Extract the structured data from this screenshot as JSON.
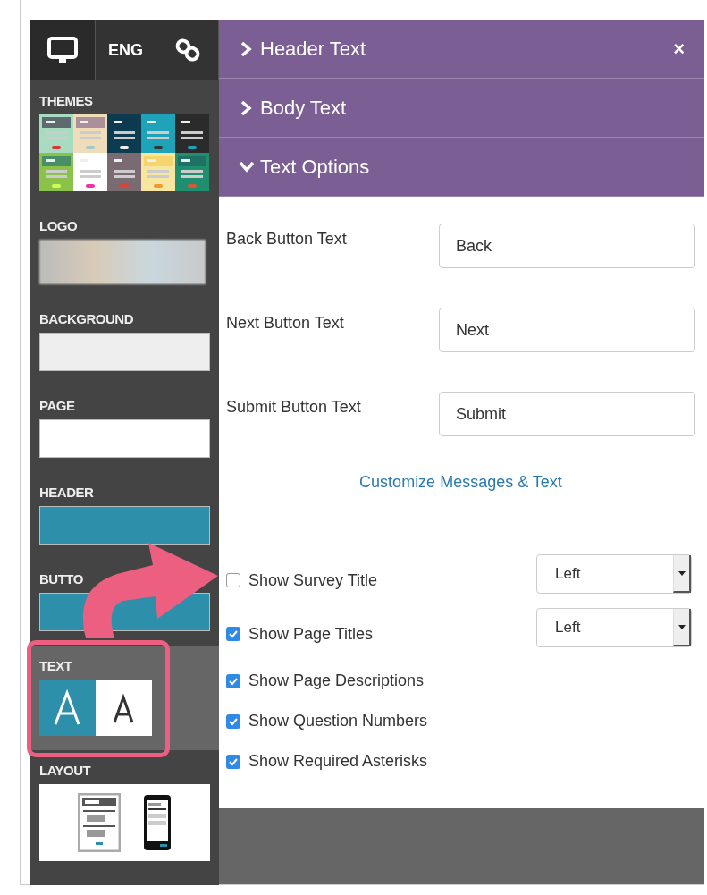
{
  "sidebar": {
    "tabs": [
      {
        "kind": "monitor",
        "selected": true
      },
      {
        "kind": "text",
        "label": "ENG",
        "selected": false
      },
      {
        "kind": "link",
        "selected": false
      }
    ],
    "sections": [
      {
        "kind": "themes",
        "label": "THEMES",
        "selected": false
      },
      {
        "kind": "logo",
        "label": "LOGO",
        "selected": false
      },
      {
        "kind": "swatch",
        "label": "BACKGROUND",
        "color": "#eeeeee",
        "selected": false
      },
      {
        "kind": "swatch",
        "label": "PAGE",
        "color": "#ffffff",
        "selected": false
      },
      {
        "kind": "swatch",
        "label": "HEADER",
        "color": "#2e8faa",
        "selected": false
      },
      {
        "kind": "swatch",
        "label": "BUTTO",
        "color": "#2e8faa",
        "selected": false
      },
      {
        "kind": "text",
        "label": "TEXT",
        "selected": true
      },
      {
        "kind": "layout",
        "label": "LAYOUT",
        "selected": false
      }
    ]
  },
  "accordion": [
    {
      "title": "Header Text",
      "expanded": false,
      "close": "×"
    },
    {
      "title": "Body Text",
      "expanded": false
    },
    {
      "title": "Text Options",
      "expanded": true
    }
  ],
  "fields": [
    {
      "label": "Back Button Text",
      "value": "Back"
    },
    {
      "label": "Next Button Text",
      "value": "Next"
    },
    {
      "label": "Submit Button Text",
      "value": "Submit"
    }
  ],
  "link": "Customize Messages & Text",
  "options": [
    {
      "label": "Show Survey Title",
      "checked": false,
      "select": "Left"
    },
    {
      "label": "Show Page Titles",
      "checked": true,
      "select": "Left"
    },
    {
      "label": "Show Page Descriptions",
      "checked": true
    },
    {
      "label": "Show Question Numbers",
      "checked": true
    },
    {
      "label": "Show Required Asterisks",
      "checked": true
    }
  ]
}
